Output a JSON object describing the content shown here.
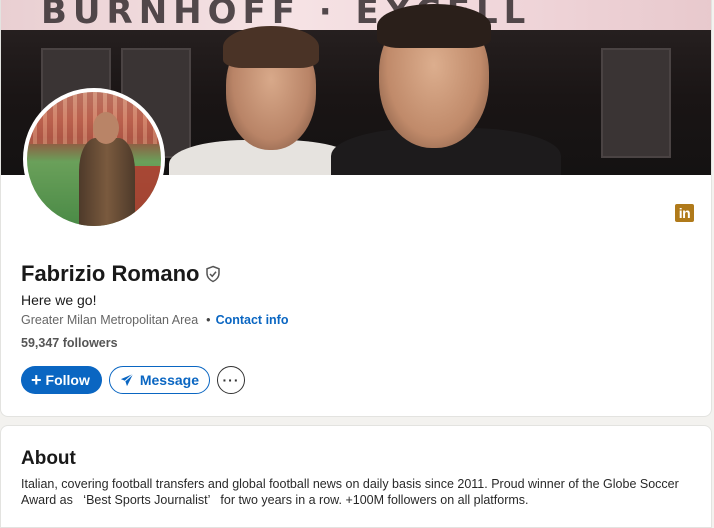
{
  "banner": {
    "sign_text": "BURNHOFF · EXCELL"
  },
  "profile": {
    "name": "Fabrizio Romano",
    "headline": "Here we go!",
    "location": "Greater Milan Metropolitan Area",
    "dot": "•",
    "contact_info": "Contact info",
    "followers": "59,347 followers",
    "linkedin_badge": "in"
  },
  "actions": {
    "follow_plus": "+",
    "follow_label": "Follow",
    "message_label": "Message",
    "more_label": "···"
  },
  "about": {
    "title": "About",
    "text": "Italian, covering football transfers and global football news on daily basis since 2011. Proud winner of the Globe Soccer Award as   ‘Best Sports Journalist’   for two years in a row. +100M followers on all platforms."
  },
  "colors": {
    "brand_blue": "#0a66c2",
    "linkedin_badge": "#b07a1a",
    "page_bg": "#f3f2ef"
  },
  "icons": {
    "verified": "shield-check-icon",
    "message": "paper-plane-icon",
    "more": "ellipsis-icon",
    "linkedin": "linkedin-icon"
  }
}
